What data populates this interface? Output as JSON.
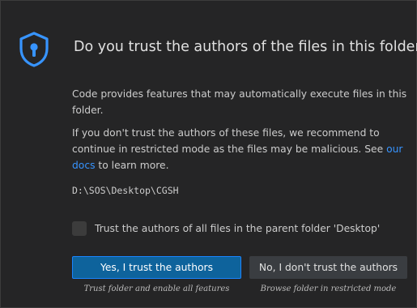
{
  "dialog": {
    "icon": "shield-lock-icon",
    "title": "Do you trust the authors of the files in this folder?",
    "paragraph1": "Code provides features that may automatically execute files in this folder.",
    "paragraph2_before_link": "If you don't trust the authors of these files, we recommend to continue in restricted mode as the files may be malicious. See ",
    "paragraph2_link": "our docs",
    "paragraph2_after_link": " to learn more.",
    "folder_path": "D:\\SOS\\Desktop\\CGSH",
    "checkbox_label": "Trust the authors of all files in the parent folder 'Desktop'",
    "checkbox_checked": false,
    "trust_button": "Yes, I trust the authors",
    "trust_caption": "Trust folder and enable all features",
    "distrust_button": "No, I don't trust the authors",
    "distrust_caption": "Browse folder in restricted mode"
  },
  "colors": {
    "background": "#252526",
    "primary_button": "#0e639c",
    "secondary_button": "#3a3d41",
    "link": "#3794ff",
    "shield": "#3794ff"
  }
}
